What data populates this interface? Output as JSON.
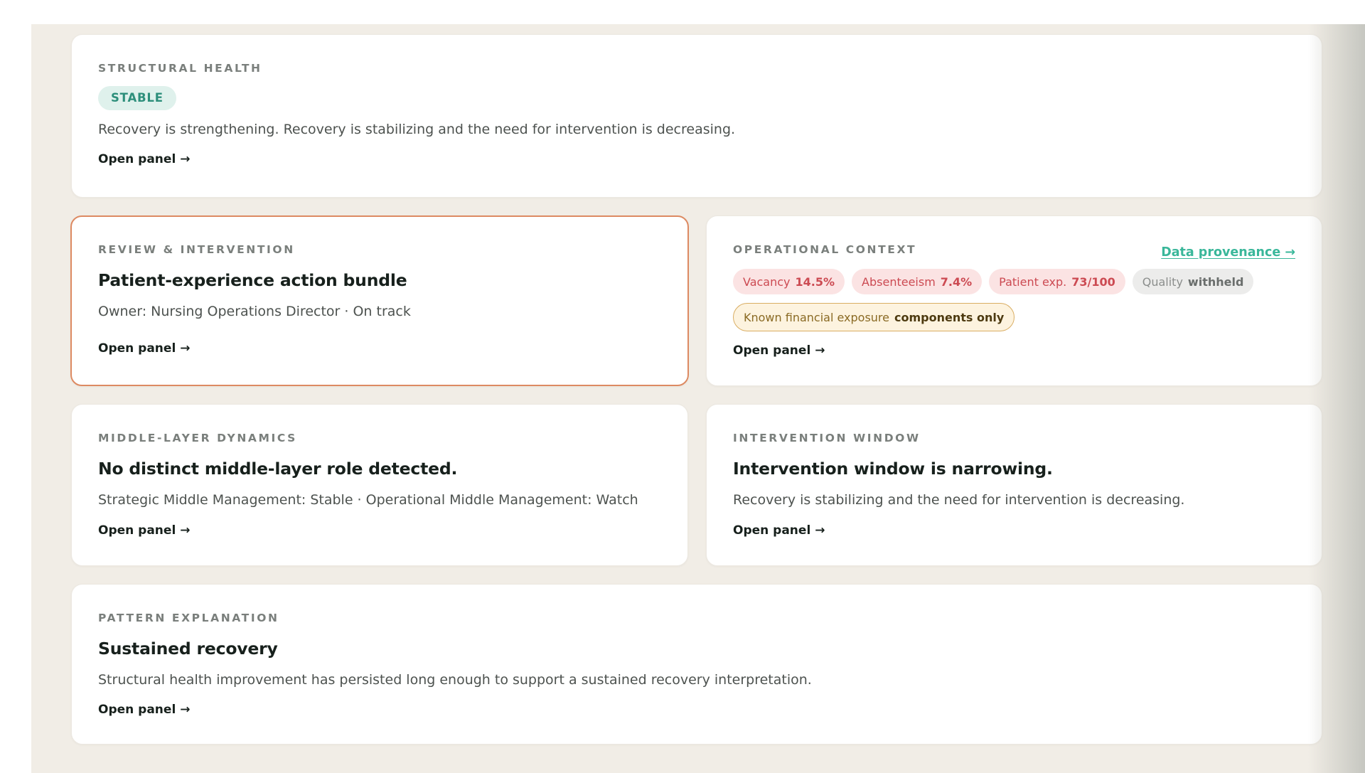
{
  "structural": {
    "eyebrow": "STRUCTURAL HEALTH",
    "status": "STABLE",
    "text": "Recovery is strengthening. Recovery is stabilizing and the need for intervention is decreasing.",
    "link": "Open panel →"
  },
  "review": {
    "eyebrow": "REVIEW & INTERVENTION",
    "title": "Patient-experience action bundle",
    "text": "Owner: Nursing Operations Director · On track",
    "link": "Open panel →"
  },
  "operational": {
    "eyebrow": "OPERATIONAL CONTEXT",
    "provenance": "Data provenance →",
    "chips": [
      {
        "label": "Vacancy",
        "value": "14.5%"
      },
      {
        "label": "Absenteeism",
        "value": "7.4%"
      },
      {
        "label": "Patient exp.",
        "value": "73/100"
      },
      {
        "label": "Quality",
        "value": "withheld"
      }
    ],
    "exposure": {
      "label": "Known financial exposure",
      "value": "components only"
    },
    "link": "Open panel →"
  },
  "middle": {
    "eyebrow": "MIDDLE-LAYER DYNAMICS",
    "title": "No distinct middle-layer role detected.",
    "text": "Strategic Middle Management: Stable · Operational Middle Management: Watch",
    "link": "Open panel →"
  },
  "window": {
    "eyebrow": "INTERVENTION WINDOW",
    "title": "Intervention window is narrowing.",
    "text": "Recovery is stabilizing and the need for intervention is decreasing.",
    "link": "Open panel →"
  },
  "pattern": {
    "eyebrow": "PATTERN EXPLANATION",
    "title": "Sustained recovery",
    "text": "Structural health improvement has persisted long enough to support a sustained recovery interpretation.",
    "link": "Open panel →"
  },
  "colors": {
    "background": "#f1ede6",
    "accent_teal": "#3ab79a",
    "highlight_border": "#dd8a62",
    "risk_red": "#cc4a52",
    "caution_amber": "#d9ad62"
  }
}
